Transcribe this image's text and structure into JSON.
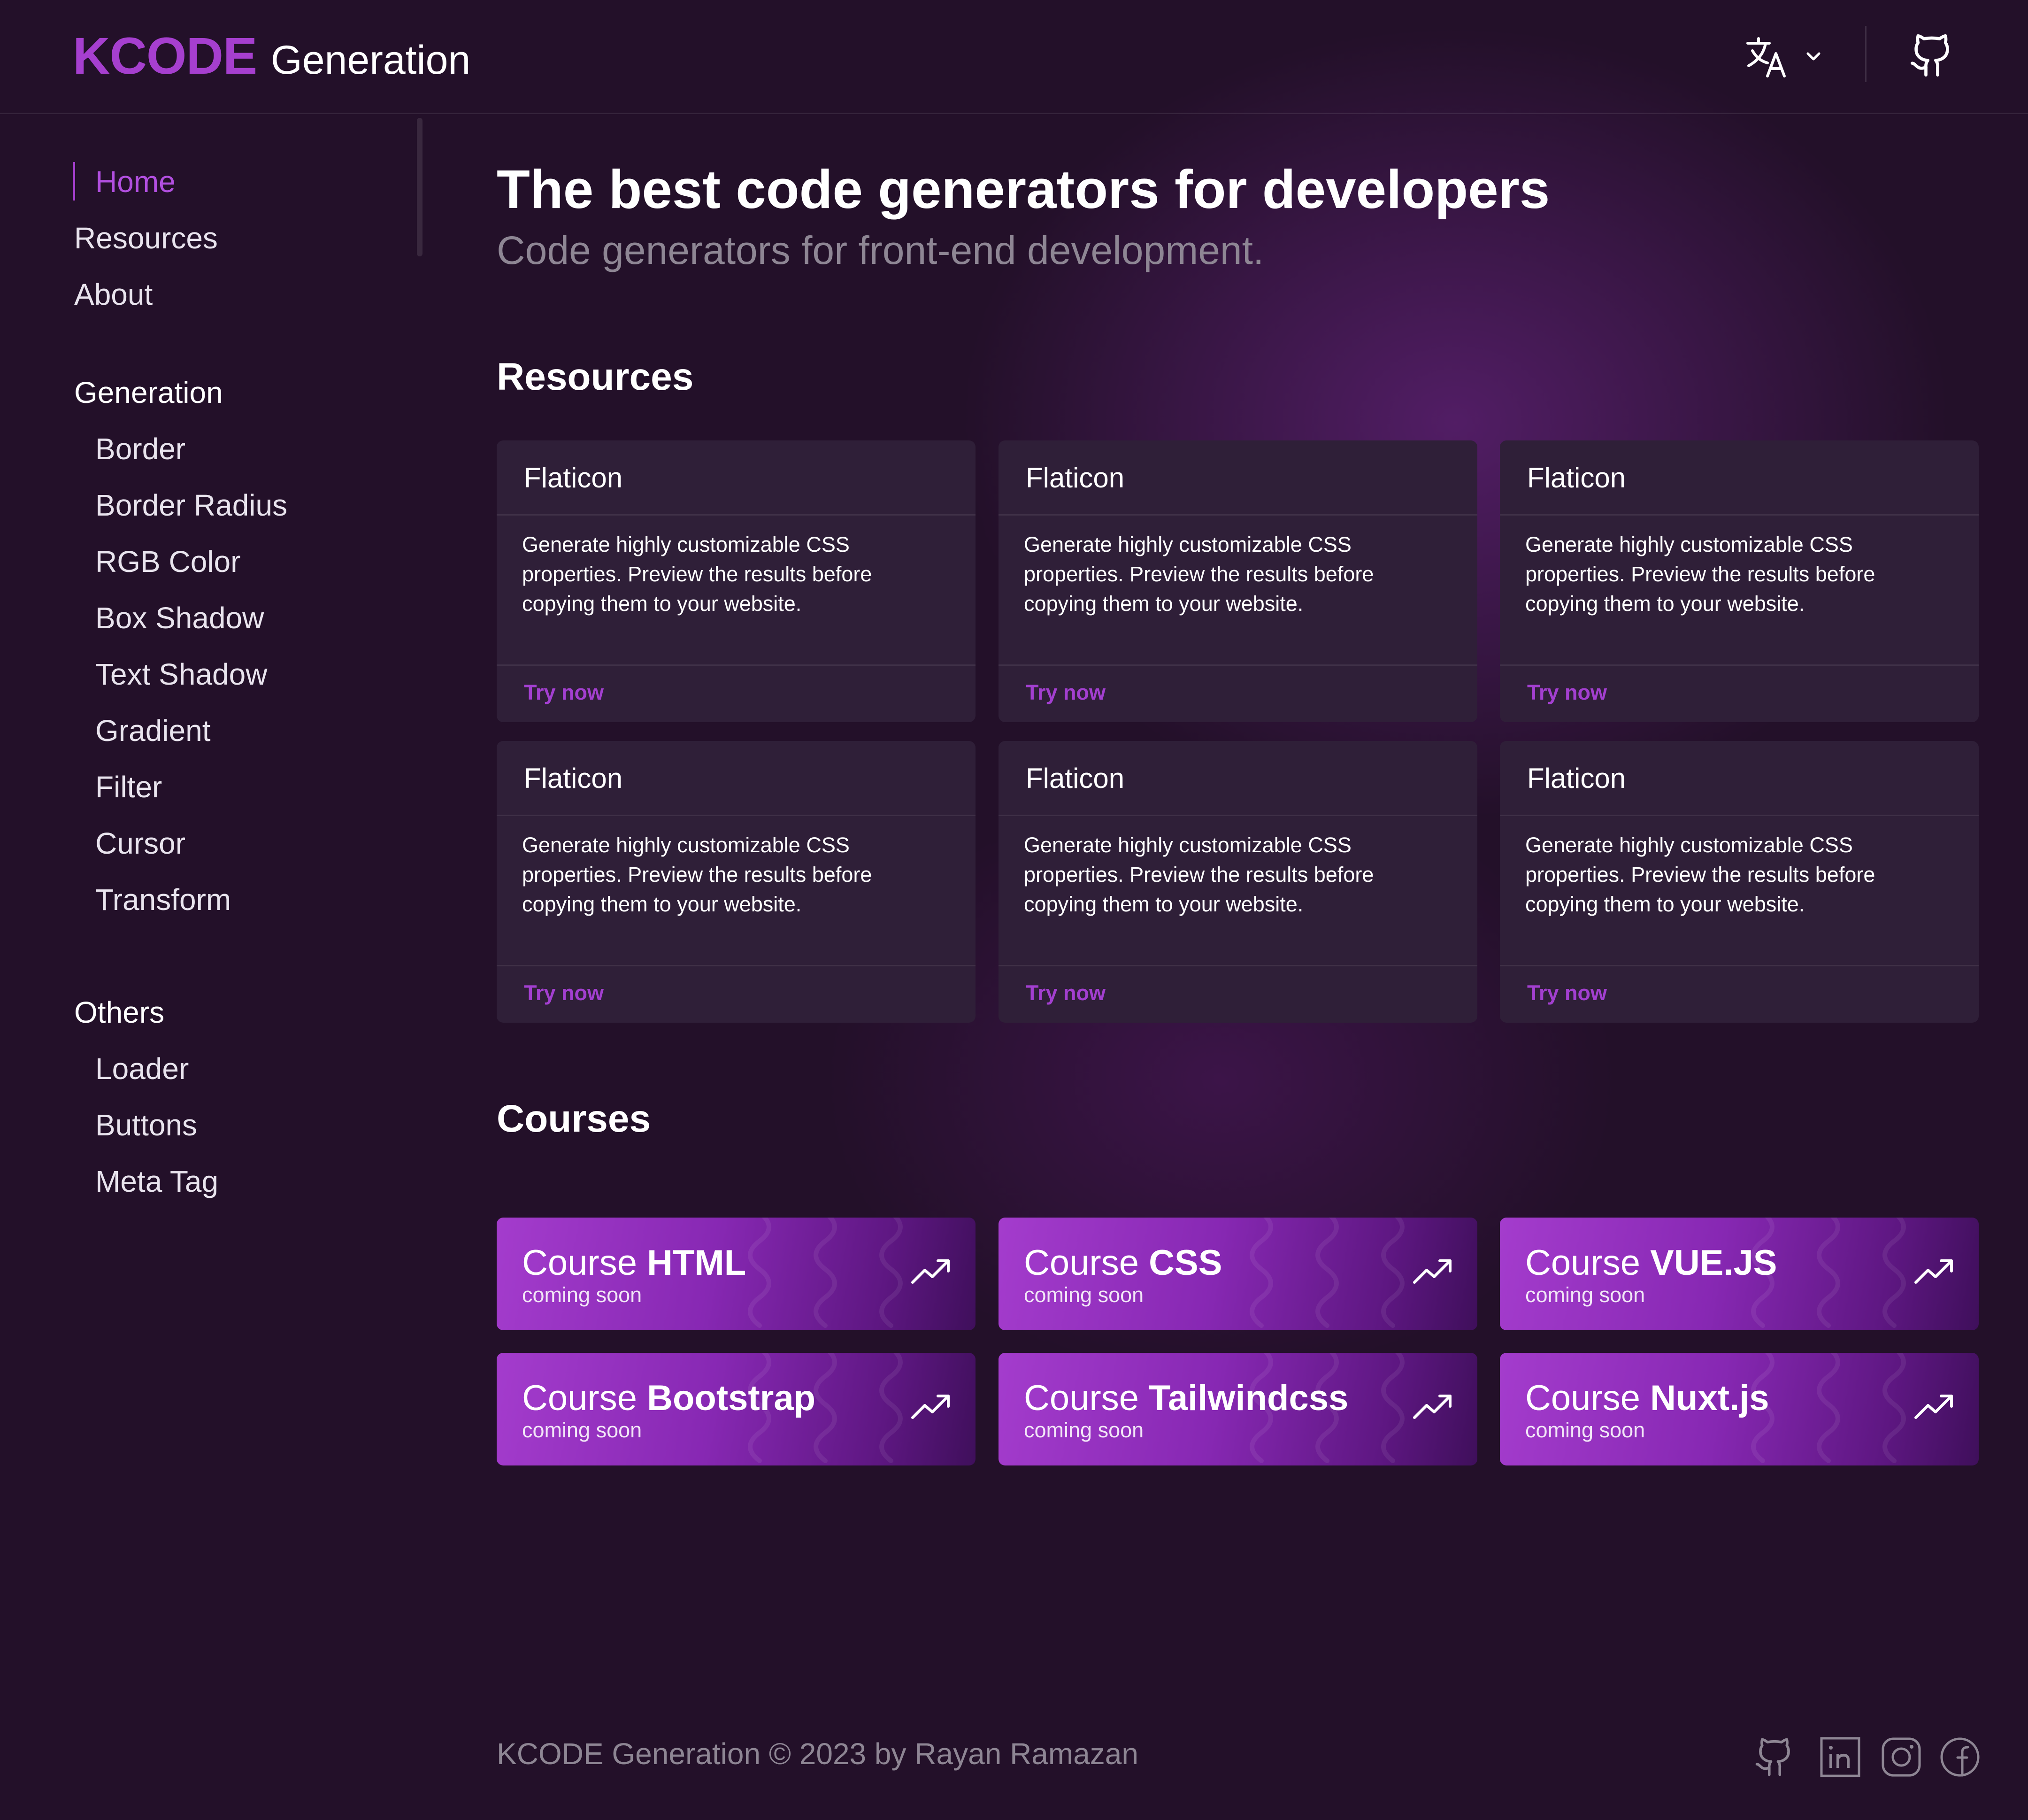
{
  "header": {
    "logo_main": "KCODE",
    "logo_sub": "Generation",
    "language_icon": "translate-icon",
    "chevron_icon": "chevron-down-icon",
    "github_icon": "github-icon"
  },
  "sidebar": {
    "nav": [
      {
        "label": "Home",
        "active": true
      },
      {
        "label": "Resources"
      },
      {
        "label": "About"
      }
    ],
    "generation": {
      "title": "Generation",
      "items": [
        "Border",
        "Border Radius",
        "RGB Color",
        "Box Shadow",
        "Text Shadow",
        "Gradient",
        "Filter",
        "Cursor",
        "Transform"
      ]
    },
    "others": {
      "title": "Others",
      "items": [
        "Loader",
        "Buttons",
        "Meta Tag"
      ]
    }
  },
  "main": {
    "title": "The best code generators for developers",
    "subtitle": "Code generators for front-end development.",
    "resources_title": "Resources",
    "resources": [
      {
        "title": "Flaticon",
        "description": "Generate highly customizable CSS properties. Preview the results before copying them to your website.",
        "link": "Try now"
      },
      {
        "title": "Flaticon",
        "description": "Generate highly customizable CSS properties. Preview the results before copying them to your website.",
        "link": "Try now"
      },
      {
        "title": "Flaticon",
        "description": "Generate highly customizable CSS properties. Preview the results before copying them to your website.",
        "link": "Try now"
      },
      {
        "title": "Flaticon",
        "description": "Generate highly customizable CSS properties. Preview the results before copying them to your website.",
        "link": "Try now"
      },
      {
        "title": "Flaticon",
        "description": "Generate highly customizable CSS properties. Preview the results before copying them to your website.",
        "link": "Try now"
      },
      {
        "title": "Flaticon",
        "description": "Generate highly customizable CSS properties. Preview the results before copying them to your website.",
        "link": "Try now"
      }
    ],
    "courses_title": "Courses",
    "courses": [
      {
        "prefix": "Course",
        "name": "HTML",
        "status": "coming soon"
      },
      {
        "prefix": "Course",
        "name": "CSS",
        "status": "coming soon"
      },
      {
        "prefix": "Course",
        "name": "VUE.JS",
        "status": "coming soon"
      },
      {
        "prefix": "Course",
        "name": "Bootstrap",
        "status": "coming soon"
      },
      {
        "prefix": "Course",
        "name": "Tailwindcss",
        "status": "coming soon"
      },
      {
        "prefix": "Course",
        "name": "Nuxt.js",
        "status": "coming soon"
      }
    ]
  },
  "footer": {
    "text": "KCODE Generation © 2023 by Rayan Ramazan",
    "social_icons": [
      "github-icon",
      "linkedin-icon",
      "instagram-icon",
      "facebook-icon"
    ]
  },
  "colors": {
    "accent": "#a63fcf",
    "background": "#231029",
    "card": "#2f1f38",
    "muted_text": "#8e8694"
  }
}
